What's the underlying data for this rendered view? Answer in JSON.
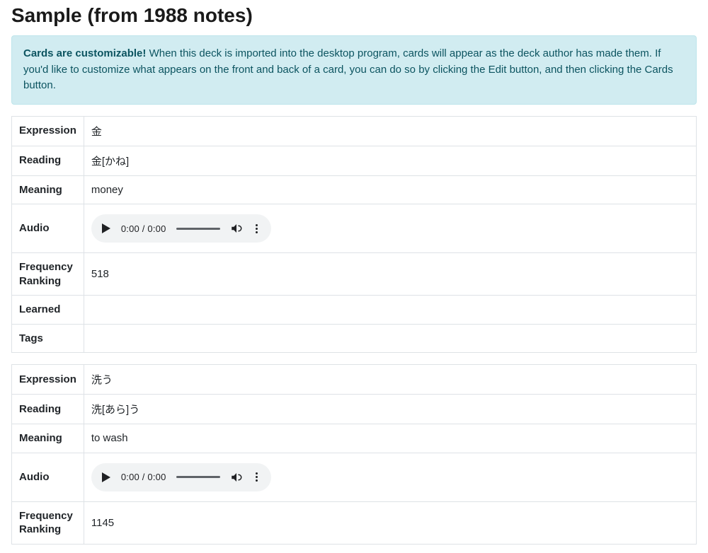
{
  "page_title": "Sample (from 1988 notes)",
  "alert": {
    "strong": "Cards are customizable!",
    "rest": " When this deck is imported into the desktop program, cards will appear as the deck author has made them. If you'd like to customize what appears on the front and back of a card, you can do so by clicking the Edit button, and then clicking the Cards button."
  },
  "labels": {
    "expression": "Expression",
    "reading": "Reading",
    "meaning": "Meaning",
    "audio": "Audio",
    "frequency_ranking": "Frequency Ranking",
    "learned": "Learned",
    "tags": "Tags"
  },
  "audio_time": "0:00 / 0:00",
  "notes": [
    {
      "expression": "金",
      "reading": "金[かね]",
      "meaning": "money",
      "frequency_ranking": "518",
      "learned": "",
      "tags": ""
    },
    {
      "expression": "洗う",
      "reading": "洗[あら]う",
      "meaning": "to wash",
      "frequency_ranking": "1145"
    }
  ]
}
